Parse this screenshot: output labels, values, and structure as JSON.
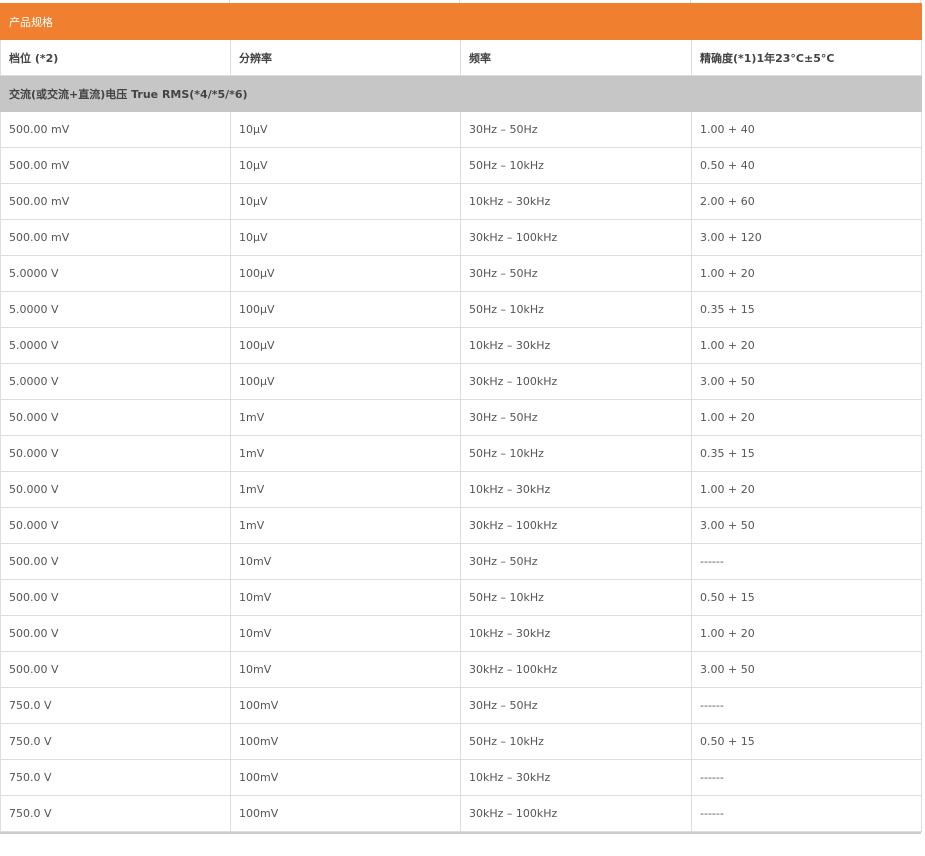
{
  "table": {
    "title": "产品规格",
    "headers": [
      "档位 (*2)",
      "分辨率",
      "频率",
      "精确度(*1)1年23°C±5°C"
    ],
    "section_label": "交流(或交流+直流)电压 True RMS(*4/*5/*6)",
    "rows": [
      [
        "500.00 mV",
        "10µV",
        "30Hz – 50Hz",
        "1.00 + 40"
      ],
      [
        "500.00 mV",
        "10µV",
        "50Hz – 10kHz",
        "0.50 + 40"
      ],
      [
        "500.00 mV",
        "10µV",
        "10kHz – 30kHz",
        "2.00 + 60"
      ],
      [
        "500.00 mV",
        "10µV",
        "30kHz – 100kHz",
        "3.00 + 120"
      ],
      [
        "5.0000 V",
        "100µV",
        "30Hz – 50Hz",
        "1.00 + 20"
      ],
      [
        "5.0000 V",
        "100µV",
        "50Hz – 10kHz",
        "0.35 + 15"
      ],
      [
        "5.0000 V",
        "100µV",
        "10kHz – 30kHz",
        "1.00 + 20"
      ],
      [
        "5.0000 V",
        "100µV",
        "30kHz – 100kHz",
        "3.00 + 50"
      ],
      [
        "50.000 V",
        "1mV",
        "30Hz – 50Hz",
        "1.00 + 20"
      ],
      [
        "50.000 V",
        "1mV",
        "50Hz – 10kHz",
        "0.35 + 15"
      ],
      [
        "50.000 V",
        "1mV",
        "10kHz – 30kHz",
        "1.00 + 20"
      ],
      [
        "50.000 V",
        "1mV",
        "30kHz – 100kHz",
        "3.00 + 50"
      ],
      [
        "500.00 V",
        "10mV",
        "30Hz – 50Hz",
        "------"
      ],
      [
        "500.00 V",
        "10mV",
        "50Hz – 10kHz",
        "0.50 + 15"
      ],
      [
        "500.00 V",
        "10mV",
        "10kHz – 30kHz",
        "1.00 + 20"
      ],
      [
        "500.00 V",
        "10mV",
        "30kHz – 100kHz",
        "3.00 + 50"
      ],
      [
        "750.0 V",
        "100mV",
        "30Hz – 50Hz",
        "------"
      ],
      [
        "750.0 V",
        "100mV",
        "50Hz – 10kHz",
        "0.50 + 15"
      ],
      [
        "750.0 V",
        "100mV",
        "10kHz – 30kHz",
        "------"
      ],
      [
        "750.0 V",
        "100mV",
        "30kHz – 100kHz",
        "------"
      ]
    ]
  },
  "colors": {
    "title_bg": "#f08030",
    "section_bg": "#c6c6c6",
    "border": "#dddddd"
  }
}
